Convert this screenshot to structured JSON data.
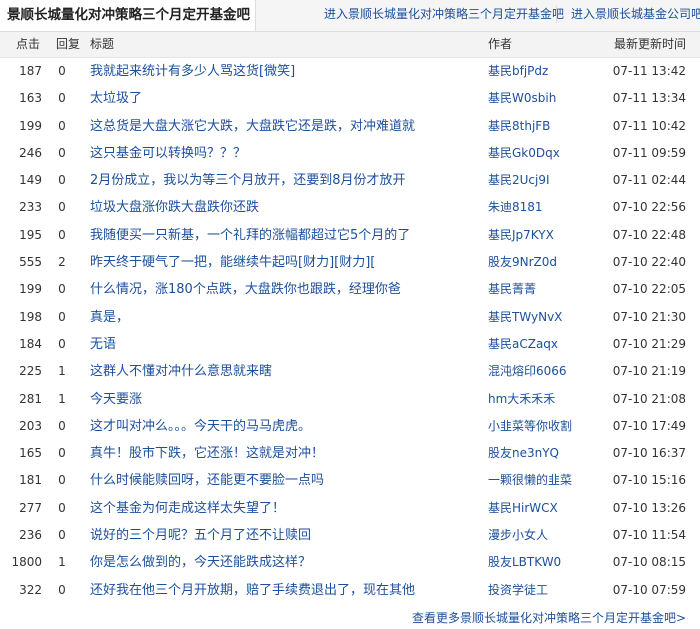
{
  "tabs": {
    "active": "景顺长城量化对冲策略三个月定开基金吧",
    "link1": "进入景顺长城量化对冲策略三个月定开基金吧",
    "link2": "进入景顺长城基金公司吧"
  },
  "columns": {
    "clicks": "点击",
    "replies": "回复",
    "title": "标题",
    "author": "作者",
    "updated": "最新更新时间"
  },
  "posts": [
    {
      "clicks": "187",
      "replies": "0",
      "title": "我就起来统计有多少人骂这货[微笑]",
      "author": "基民bfjPdz",
      "time": "07-11 13:42"
    },
    {
      "clicks": "163",
      "replies": "0",
      "title": "太垃圾了",
      "author": "基民W0sbih",
      "time": "07-11 13:34"
    },
    {
      "clicks": "199",
      "replies": "0",
      "title": "这总货是大盘大涨它大跌，大盘跌它还是跌，对冲难道就",
      "author": "基民8thjFB",
      "time": "07-11 10:42"
    },
    {
      "clicks": "246",
      "replies": "0",
      "title": "这只基金可以转换吗？？？",
      "author": "基民Gk0Dqx",
      "time": "07-11 09:59"
    },
    {
      "clicks": "149",
      "replies": "0",
      "title": "2月份成立，我以为等三个月放开，还要到8月份才放开",
      "author": "基民2Ucj9I",
      "time": "07-11 02:44"
    },
    {
      "clicks": "233",
      "replies": "0",
      "title": "垃圾大盘涨你跌大盘跌你还跌",
      "author": "朱迪8181",
      "time": "07-10 22:56"
    },
    {
      "clicks": "195",
      "replies": "0",
      "title": "我随便买一只新基，一个礼拜的涨幅都超过它5个月的了",
      "author": "基民Jp7KYX",
      "time": "07-10 22:48"
    },
    {
      "clicks": "555",
      "replies": "2",
      "title": "昨天终于硬气了一把，能继续牛起吗[财力][财力][",
      "author": "股友9NrZ0d",
      "time": "07-10 22:40"
    },
    {
      "clicks": "199",
      "replies": "0",
      "title": "什么情况，涨180个点跌，大盘跌你也跟跌，经理你爸",
      "author": "基民菁菁",
      "time": "07-10 22:05"
    },
    {
      "clicks": "198",
      "replies": "0",
      "title": "真是，",
      "author": "基民TWyNvX",
      "time": "07-10 21:30"
    },
    {
      "clicks": "184",
      "replies": "0",
      "title": "无语",
      "author": "基民aCZaqx",
      "time": "07-10 21:29"
    },
    {
      "clicks": "225",
      "replies": "1",
      "title": "这群人不懂对冲什么意思就来瞎",
      "author": "混沌熔印6066",
      "time": "07-10 21:19"
    },
    {
      "clicks": "281",
      "replies": "1",
      "title": "今天要涨",
      "author": "hm大禾禾禾",
      "time": "07-10 21:08"
    },
    {
      "clicks": "203",
      "replies": "0",
      "title": "这才叫对冲么。。。今天干的马马虎虎。",
      "author": "小韭菜等你收割",
      "time": "07-10 17:49"
    },
    {
      "clicks": "165",
      "replies": "0",
      "title": "真牛！股市下跌，它还涨！这就是对冲！",
      "author": "股友ne3nYQ",
      "time": "07-10 16:37"
    },
    {
      "clicks": "181",
      "replies": "0",
      "title": "什么时候能赎回呀，还能更不要脸一点吗",
      "author": "一颗很懒的韭菜",
      "time": "07-10 15:16"
    },
    {
      "clicks": "277",
      "replies": "0",
      "title": "这个基金为何走成这样太失望了！",
      "author": "基民HirWCX",
      "time": "07-10 13:26"
    },
    {
      "clicks": "236",
      "replies": "0",
      "title": "说好的三个月呢？五个月了还不让赎回",
      "author": "漫步小女人",
      "time": "07-10 11:54"
    },
    {
      "clicks": "1800",
      "replies": "1",
      "title": "你是怎么做到的，今天还能跌成这样？",
      "author": "股友LBTKW0",
      "time": "07-10 08:15"
    },
    {
      "clicks": "322",
      "replies": "0",
      "title": "还好我在他三个月开放期，赔了手续费退出了，现在其他",
      "author": "投资学徒工",
      "time": "07-10 07:59"
    }
  ],
  "more_link": "查看更多景顺长城量化对冲策略三个月定开基金吧>"
}
